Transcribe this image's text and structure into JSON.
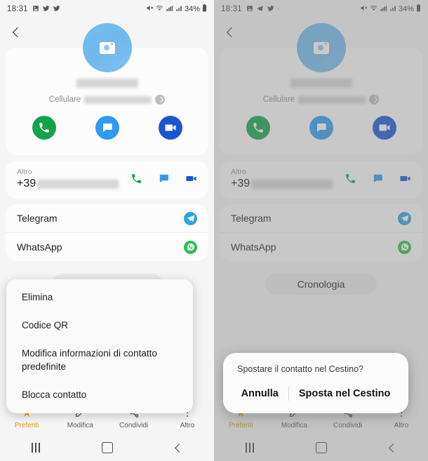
{
  "status_bar": {
    "time": "18:31",
    "left_icons": [
      "photos-icon",
      "telegram-icon",
      "twitter-icon"
    ],
    "right_icons": [
      "mute-icon",
      "wifi-icon",
      "signal-icon",
      "signal-bars-icon"
    ],
    "battery": "34%"
  },
  "appbar": {
    "back_icon": "back-chevron-icon"
  },
  "contact": {
    "avatar_icon": "camera-placeholder-icon",
    "name_redacted": true,
    "phone_label": "Cellulare",
    "phone_redacted": true,
    "expand_icon": "chevron-right-icon",
    "actions": [
      {
        "name": "call",
        "icon": "phone-icon",
        "color": "#12a34a"
      },
      {
        "name": "message",
        "icon": "message-icon",
        "color": "#2e9bf0"
      },
      {
        "name": "video",
        "icon": "video-camera-icon",
        "color": "#1b55d4"
      }
    ]
  },
  "other_number": {
    "label": "Altro",
    "prefix": "+39",
    "redacted": true,
    "icons": [
      {
        "name": "phone-icon",
        "color": "#12a34a"
      },
      {
        "name": "message-icon",
        "color": "#2e9bf0"
      },
      {
        "name": "video-camera-icon",
        "color": "#1b55d4"
      }
    ]
  },
  "app_rows": [
    {
      "label": "Telegram",
      "badge": "telegram-icon",
      "badge_color": "#2da5e0"
    },
    {
      "label": "WhatsApp",
      "badge": "whatsapp-icon",
      "badge_color": "#2cc14c"
    }
  ],
  "history_button": {
    "label": "Cronologia"
  },
  "context_menu": {
    "items": [
      {
        "label": "Elimina"
      },
      {
        "label": "Codice QR"
      },
      {
        "label": "Modifica informazioni di contatto predefinite"
      },
      {
        "label": "Blocca contatto"
      }
    ]
  },
  "toolbar": {
    "items": [
      {
        "label": "Preferiti",
        "icon": "star-icon"
      },
      {
        "label": "Modifica",
        "icon": "pencil-icon"
      },
      {
        "label": "Condividi",
        "icon": "share-icon"
      },
      {
        "label": "Altro",
        "icon": "more-vertical-icon"
      }
    ]
  },
  "nav_bar": {
    "recent_icon": "recents-icon",
    "home_icon": "home-icon",
    "back_icon": "back-icon"
  },
  "confirm_dialog": {
    "message": "Spostare il contatto nel Cestino?",
    "cancel_label": "Annulla",
    "confirm_label": "Sposta nel Cestino"
  },
  "colors": {
    "call_green": "#12a34a",
    "message_blue": "#2e9bf0",
    "video_blue": "#1b55d4",
    "telegram_blue": "#2da5e0",
    "whatsapp_green": "#2cc14c",
    "star_gold": "#f0a81c"
  }
}
